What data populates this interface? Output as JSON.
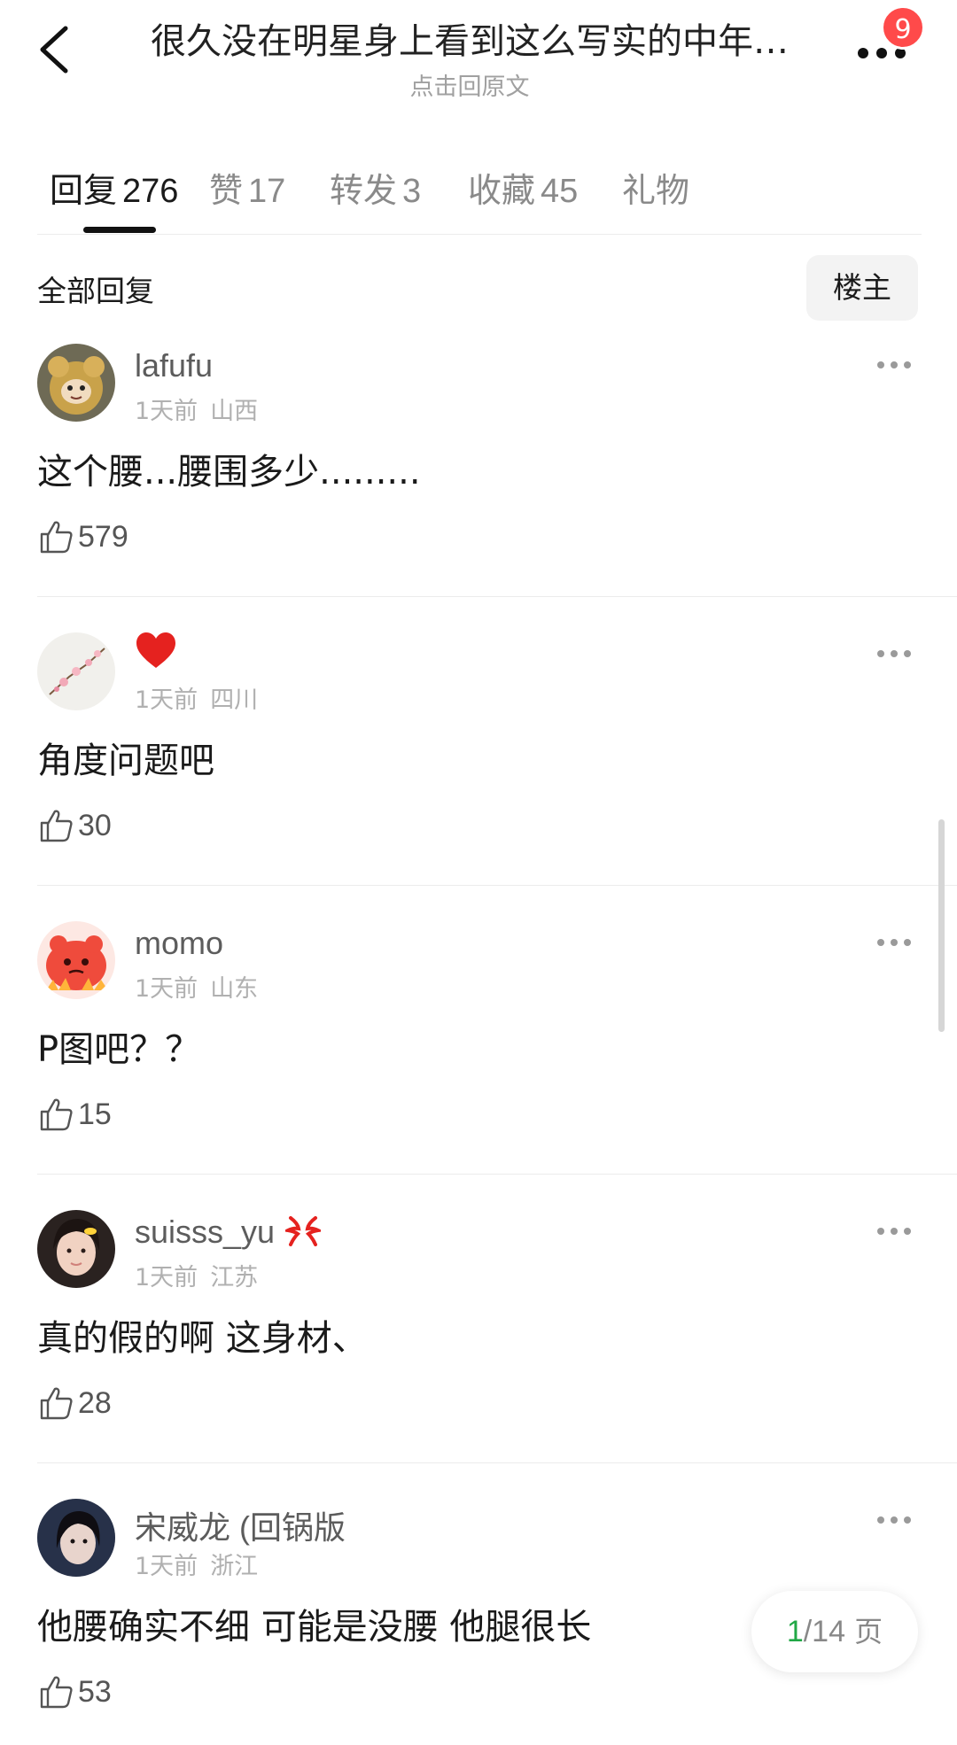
{
  "header": {
    "title": "很久没在明星身上看到这么写实的中年…",
    "subtitle": "点击回原文",
    "badge_count": "9"
  },
  "tabs": [
    {
      "label": "回复",
      "count": "276",
      "active": true
    },
    {
      "label": "赞",
      "count": "17"
    },
    {
      "label": "转发",
      "count": "3"
    },
    {
      "label": "收藏",
      "count": "45"
    },
    {
      "label": "礼物",
      "count": ""
    }
  ],
  "filter": {
    "all_label": "全部回复",
    "op_label": "楼主"
  },
  "comments": [
    {
      "username": "lafufu",
      "time": "1天前",
      "location": "山西",
      "content": "这个腰...腰围多少.........",
      "likes": "579",
      "avatar": "plush-toy"
    },
    {
      "username": "",
      "username_emoji": "heart",
      "time": "1天前",
      "location": "四川",
      "content": "角度问题吧",
      "likes": "30",
      "avatar": "plum-blossom"
    },
    {
      "username": "momo",
      "time": "1天前",
      "location": "山东",
      "content": "P图吧？？",
      "likes": "15",
      "avatar": "red-cartoon"
    },
    {
      "username": "suisss_yu",
      "username_emoji": "anger",
      "time": "1天前",
      "location": "江苏",
      "content": "真的假的啊 这身材、",
      "likes": "28",
      "avatar": "girl-photo"
    },
    {
      "username": "宋威龙 (回锅版",
      "time": "1天前",
      "location": "浙江",
      "content": "他腰确实不细 可能是没腰 他腿很长",
      "likes": "53",
      "avatar": "dark-photo"
    }
  ],
  "pager": {
    "current": "1",
    "total": "/14",
    "unit": " 页"
  },
  "colors": {
    "badge": "#ff4a4a",
    "pager_current": "#21a846",
    "muted_text": "#b0b0b0"
  }
}
